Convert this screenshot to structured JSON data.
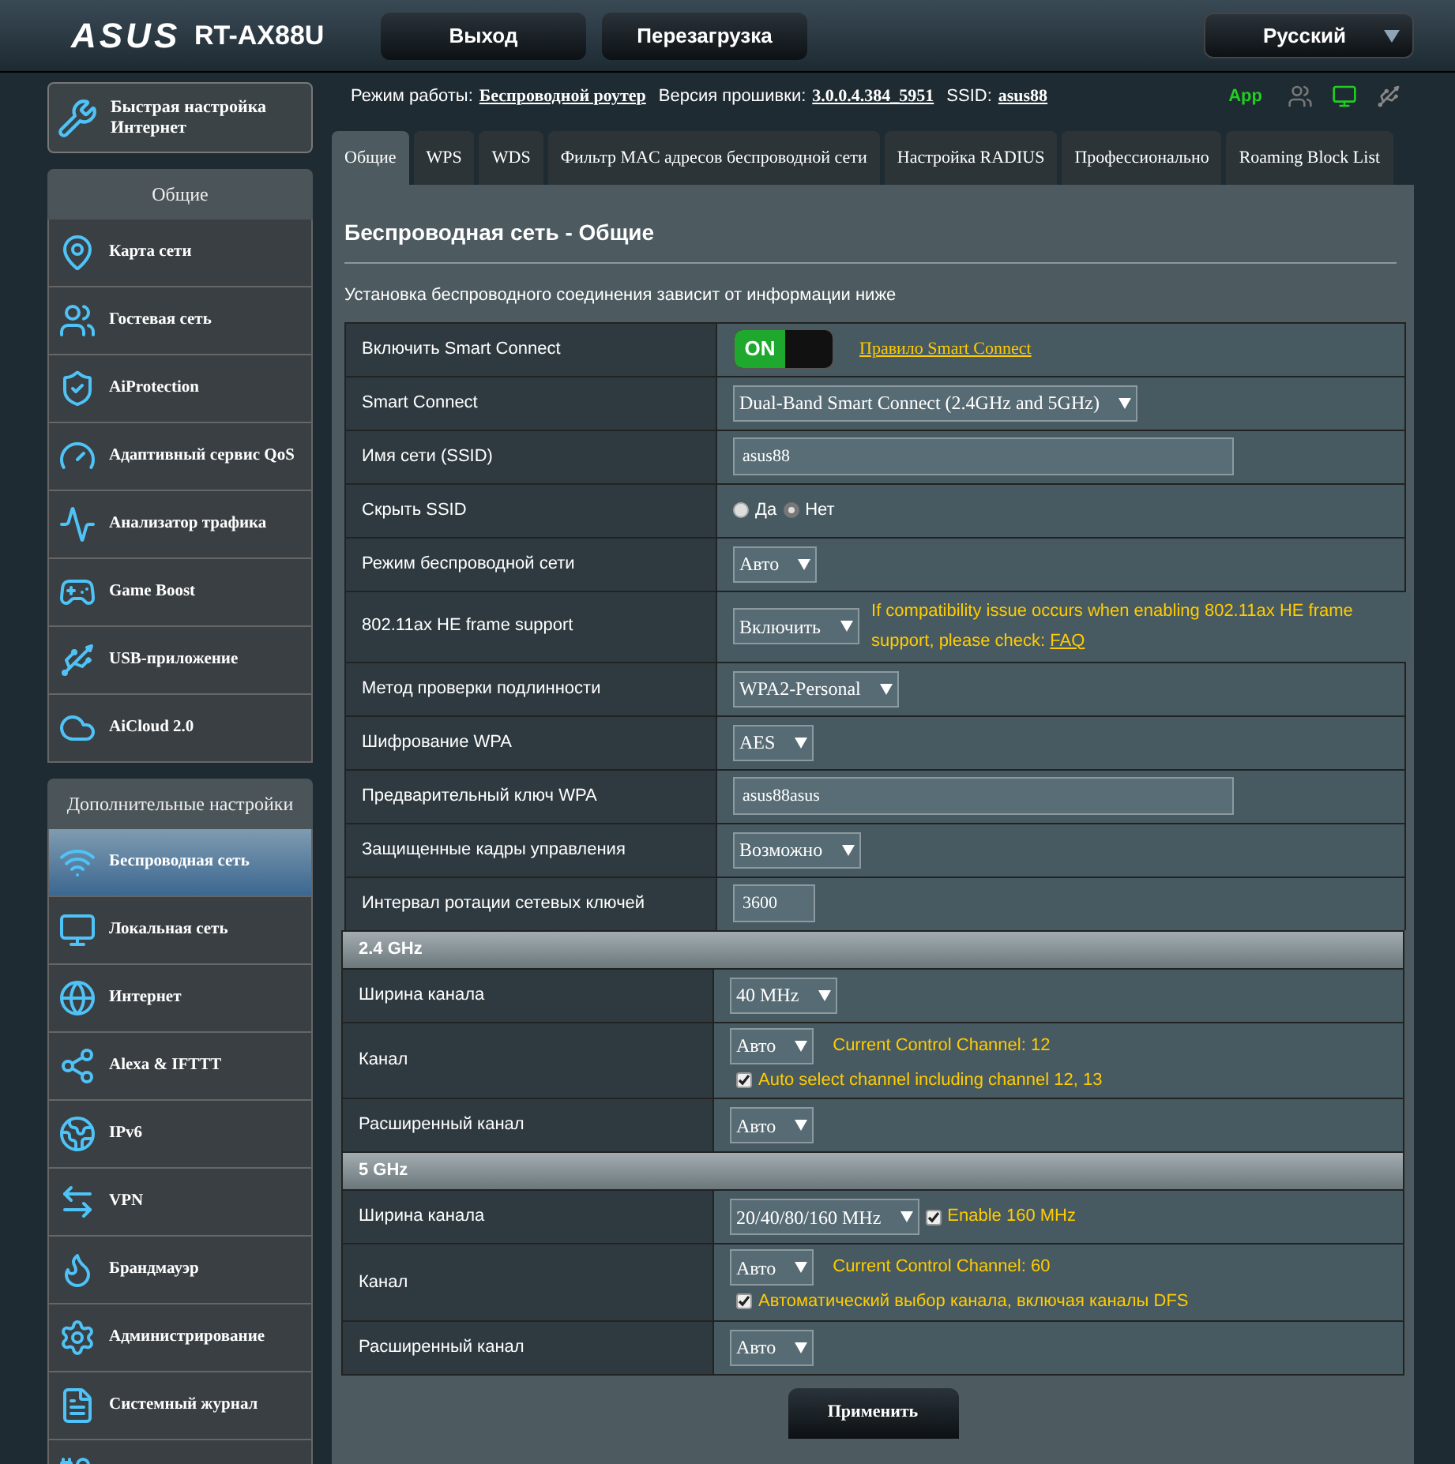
{
  "header": {
    "logo": "ASUS",
    "model": "RT-AX88U",
    "buttons": [
      "Выход",
      "Перезагрузка"
    ],
    "language": "Русский"
  },
  "quick_setup": "Быстрая настройка Интернет",
  "sidebar": [
    {
      "title": "Общие",
      "items": [
        {
          "label": "Карта сети",
          "selected": false
        },
        {
          "label": "Гостевая сеть",
          "selected": false
        },
        {
          "label": "AiProtection",
          "selected": false
        },
        {
          "label": "Адаптивный сервис QoS",
          "selected": false
        },
        {
          "label": "Анализатор трафика",
          "selected": false
        },
        {
          "label": "Game Boost",
          "selected": false
        },
        {
          "label": "USB-приложение",
          "selected": false
        },
        {
          "label": "AiCloud 2.0",
          "selected": false
        }
      ]
    },
    {
      "title": "Дополнительные настройки",
      "items": [
        {
          "label": "Беспроводная сеть",
          "selected": true
        },
        {
          "label": "Локальная сеть",
          "selected": false
        },
        {
          "label": "Интернет",
          "selected": false
        },
        {
          "label": "Alexa & IFTTT",
          "selected": false
        },
        {
          "label": "IPv6",
          "selected": false
        },
        {
          "label": "VPN",
          "selected": false
        },
        {
          "label": "Брандмауэр",
          "selected": false
        },
        {
          "label": "Администрирование",
          "selected": false
        },
        {
          "label": "Системный журнал",
          "selected": false
        }
      ]
    }
  ],
  "status": {
    "mode_label": "Режим работы:",
    "mode": "Беспроводной роутер",
    "firmware_label": "Версия прошивки:",
    "firmware": "3.0.0.4.384_5951",
    "ssid_label": "SSID:",
    "ssid": "asus88",
    "app": "App"
  },
  "tabs": [
    {
      "label": "Общие",
      "selected": true
    },
    {
      "label": "WPS",
      "selected": false
    },
    {
      "label": "WDS",
      "selected": false
    },
    {
      "label": "Фильтр MAC адресов беспроводной сети",
      "selected": false
    },
    {
      "label": "Настройка RADIUS",
      "selected": false
    },
    {
      "label": "Профессионально",
      "selected": false
    },
    {
      "label": "Roaming Block List",
      "selected": false
    }
  ],
  "panel": {
    "title": "Беспроводная сеть - Общие",
    "subtitle": "Установка беспроводного соединения зависит от информации ниже",
    "sections": [
      {
        "rows": [
          {
            "label": "Включить Smart Connect",
            "lines": [
              [
                {
                  "kind": "toggle",
                  "on": true,
                  "text": "ON"
                },
                {
                  "kind": "link",
                  "text": "Правило Smart Connect"
                }
              ]
            ]
          },
          {
            "label": "Smart Connect",
            "lines": [
              [
                {
                  "kind": "select",
                  "value": "Dual-Band Smart Connect (2.4GHz and 5GHz)"
                }
              ]
            ]
          },
          {
            "label": "Имя сети (SSID)",
            "lines": [
              [
                {
                  "kind": "input",
                  "value": "asus88"
                }
              ]
            ]
          },
          {
            "label": "Скрыть SSID",
            "lines": [
              [
                {
                  "kind": "radio",
                  "label": "Да",
                  "selected": false
                },
                {
                  "kind": "radio",
                  "label": "Нет",
                  "selected": true
                }
              ]
            ]
          },
          {
            "label": "Режим беспроводной сети",
            "lines": [
              [
                {
                  "kind": "select",
                  "value": "Авто"
                }
              ]
            ]
          },
          {
            "label": "802.11ax HE frame support",
            "lines": [
              [
                {
                  "kind": "select",
                  "value": "Включить"
                },
                {
                  "kind": "note",
                  "text": "If compatibility issue occurs when enabling 802.11ax HE frame support, please check:",
                  "link": "FAQ"
                }
              ]
            ]
          },
          {
            "label": "Метод проверки подлинности",
            "lines": [
              [
                {
                  "kind": "select",
                  "value": "WPA2-Personal"
                }
              ]
            ]
          },
          {
            "label": "Шифрование WPA",
            "lines": [
              [
                {
                  "kind": "select",
                  "value": "AES"
                }
              ]
            ]
          },
          {
            "label": "Предварительный ключ WPA",
            "lines": [
              [
                {
                  "kind": "input",
                  "value": "asus88asus"
                }
              ]
            ]
          },
          {
            "label": "Защищенные кадры управления",
            "lines": [
              [
                {
                  "kind": "select",
                  "value": "Возможно"
                }
              ]
            ]
          },
          {
            "label": "Интервал ротации сетевых ключей",
            "lines": [
              [
                {
                  "kind": "short_input",
                  "value": "3600"
                }
              ]
            ]
          }
        ]
      },
      {
        "title": "2.4 GHz",
        "rows": [
          {
            "label": "Ширина канала",
            "lines": [
              [
                {
                  "kind": "select",
                  "value": "40 MHz"
                }
              ]
            ]
          },
          {
            "label": "Канал",
            "lines": [
              [
                {
                  "kind": "select",
                  "value": "Авто"
                },
                {
                  "kind": "info",
                  "text": "Current Control Channel: 12"
                }
              ],
              [
                {
                  "kind": "checkbox",
                  "checked": true,
                  "label": "Auto select channel including channel 12, 13"
                }
              ]
            ]
          },
          {
            "label": "Расширенный канал",
            "lines": [
              [
                {
                  "kind": "select",
                  "value": "Авто"
                }
              ]
            ]
          }
        ]
      },
      {
        "title": "5 GHz",
        "rows": [
          {
            "label": "Ширина канала",
            "lines": [
              [
                {
                  "kind": "select",
                  "value": "20/40/80/160 MHz"
                },
                {
                  "kind": "checkbox",
                  "checked": true,
                  "label": "Enable 160 MHz"
                }
              ]
            ]
          },
          {
            "label": "Канал",
            "lines": [
              [
                {
                  "kind": "select",
                  "value": "Авто"
                },
                {
                  "kind": "info",
                  "text": "Current Control Channel: 60"
                }
              ],
              [
                {
                  "kind": "checkbox",
                  "checked": true,
                  "label": "Автоматический выбор канала, включая каналы DFS"
                }
              ]
            ]
          },
          {
            "label": "Расширенный канал",
            "lines": [
              [
                {
                  "kind": "select",
                  "value": "Авто"
                }
              ]
            ]
          }
        ]
      }
    ],
    "apply": "Применить"
  }
}
